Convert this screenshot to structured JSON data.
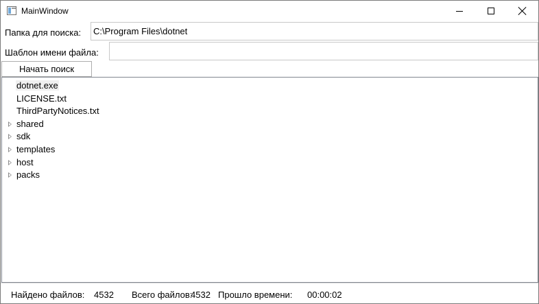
{
  "window": {
    "title": "MainWindow"
  },
  "form": {
    "folder_label": "Папка для поиска:",
    "folder_value": "C:\\Program Files\\dotnet",
    "pattern_label": "Шаблон имени файла:",
    "pattern_value": "",
    "search_button": "Начать поиск"
  },
  "tree": {
    "items": [
      {
        "label": "dotnet.exe",
        "expandable": false,
        "selected": true
      },
      {
        "label": "LICENSE.txt",
        "expandable": false
      },
      {
        "label": "ThirdPartyNotices.txt",
        "expandable": false
      },
      {
        "label": "shared",
        "expandable": true
      },
      {
        "label": "sdk",
        "expandable": true
      },
      {
        "label": "templates",
        "expandable": true
      },
      {
        "label": "host",
        "expandable": true
      },
      {
        "label": "packs",
        "expandable": true
      }
    ]
  },
  "status": {
    "found_label": "Найдено файлов:",
    "found_value": "4532",
    "total_label": "Всего файлов:",
    "total_value": "4532",
    "elapsed_label": "Прошло времени:",
    "elapsed_value": "00:00:02"
  },
  "icons": {
    "app": "window-app-icon",
    "minimize": "minimize-icon",
    "maximize": "maximize-icon",
    "close": "close-icon",
    "expander": "tree-expander-icon"
  },
  "colors": {
    "selection_bg": "#f0f0f0",
    "border": "#828790"
  }
}
